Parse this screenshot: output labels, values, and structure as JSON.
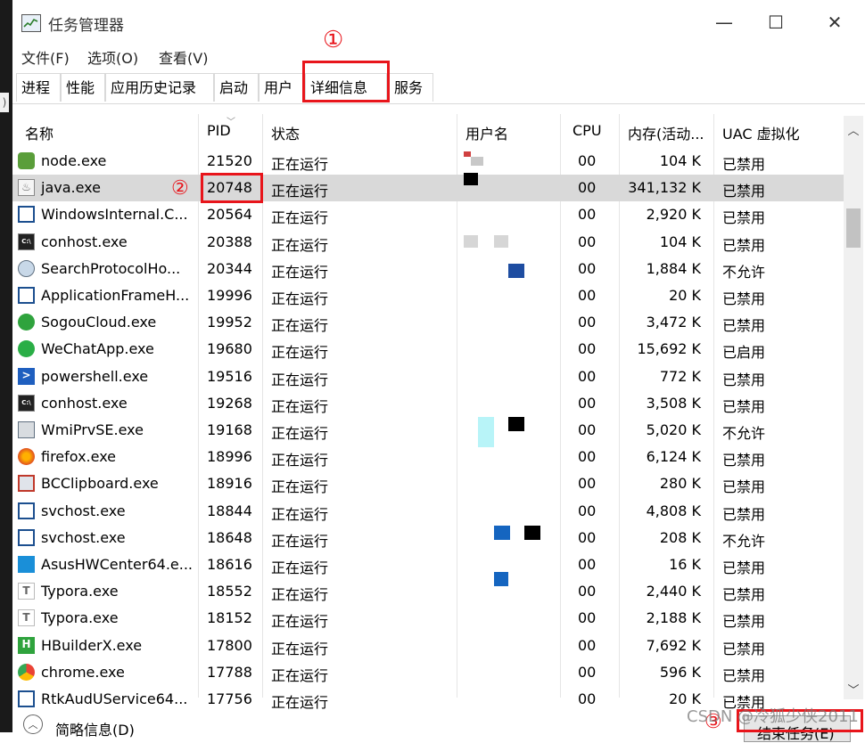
{
  "window": {
    "title": "任务管理器",
    "controls": {
      "minimize": "—",
      "maximize": "☐",
      "close": "✕"
    }
  },
  "menu": [
    "文件(F)",
    "选项(O)",
    "查看(V)"
  ],
  "tabs": [
    "进程",
    "性能",
    "应用历史记录",
    "启动",
    "用户",
    "详细信息",
    "服务"
  ],
  "active_tab": "详细信息",
  "annotations": {
    "one": "①",
    "two": "②",
    "three": "③"
  },
  "columns": {
    "name": "名称",
    "pid": "PID",
    "status": "状态",
    "user": "用户名",
    "cpu": "CPU",
    "memory": "内存(活动...",
    "uac": "UAC 虚拟化"
  },
  "rows": [
    {
      "name": "node.exe",
      "pid": "21520",
      "status": "正在运行",
      "cpu": "00",
      "memory": "104 K",
      "uac": "已禁用",
      "icon": "node-icon"
    },
    {
      "name": "java.exe",
      "pid": "20748",
      "status": "正在运行",
      "cpu": "00",
      "memory": "341,132 K",
      "uac": "已禁用",
      "icon": "java-icon"
    },
    {
      "name": "WindowsInternal.C...",
      "pid": "20564",
      "status": "正在运行",
      "cpu": "00",
      "memory": "2,920 K",
      "uac": "已禁用",
      "icon": "window-app-icon"
    },
    {
      "name": "conhost.exe",
      "pid": "20388",
      "status": "正在运行",
      "cpu": "00",
      "memory": "104 K",
      "uac": "已禁用",
      "icon": "console-icon"
    },
    {
      "name": "SearchProtocolHo...",
      "pid": "20344",
      "status": "正在运行",
      "cpu": "00",
      "memory": "1,884 K",
      "uac": "不允许",
      "icon": "search-user-icon"
    },
    {
      "name": "ApplicationFrameH...",
      "pid": "19996",
      "status": "正在运行",
      "cpu": "00",
      "memory": "20 K",
      "uac": "已禁用",
      "icon": "window-app-icon"
    },
    {
      "name": "SogouCloud.exe",
      "pid": "19952",
      "status": "正在运行",
      "cpu": "00",
      "memory": "3,472 K",
      "uac": "已禁用",
      "icon": "sogou-icon"
    },
    {
      "name": "WeChatApp.exe",
      "pid": "19680",
      "status": "正在运行",
      "cpu": "00",
      "memory": "15,692 K",
      "uac": "已启用",
      "icon": "wechat-icon"
    },
    {
      "name": "powershell.exe",
      "pid": "19516",
      "status": "正在运行",
      "cpu": "00",
      "memory": "772 K",
      "uac": "已禁用",
      "icon": "powershell-icon"
    },
    {
      "name": "conhost.exe",
      "pid": "19268",
      "status": "正在运行",
      "cpu": "00",
      "memory": "3,508 K",
      "uac": "已禁用",
      "icon": "console-icon"
    },
    {
      "name": "WmiPrvSE.exe",
      "pid": "19168",
      "status": "正在运行",
      "cpu": "00",
      "memory": "5,020 K",
      "uac": "不允许",
      "icon": "wmi-icon"
    },
    {
      "name": "firefox.exe",
      "pid": "18996",
      "status": "正在运行",
      "cpu": "00",
      "memory": "6,124 K",
      "uac": "已禁用",
      "icon": "firefox-icon"
    },
    {
      "name": "BCClipboard.exe",
      "pid": "18916",
      "status": "正在运行",
      "cpu": "00",
      "memory": "280 K",
      "uac": "已禁用",
      "icon": "clipboard-icon"
    },
    {
      "name": "svchost.exe",
      "pid": "18844",
      "status": "正在运行",
      "cpu": "00",
      "memory": "4,808 K",
      "uac": "已禁用",
      "icon": "window-app-icon"
    },
    {
      "name": "svchost.exe",
      "pid": "18648",
      "status": "正在运行",
      "cpu": "00",
      "memory": "208 K",
      "uac": "不允许",
      "icon": "window-app-icon"
    },
    {
      "name": "AsusHWCenter64.e...",
      "pid": "18616",
      "status": "正在运行",
      "cpu": "00",
      "memory": "16 K",
      "uac": "已禁用",
      "icon": "asus-icon"
    },
    {
      "name": "Typora.exe",
      "pid": "18552",
      "status": "正在运行",
      "cpu": "00",
      "memory": "2,440 K",
      "uac": "已禁用",
      "icon": "typora-icon"
    },
    {
      "name": "Typora.exe",
      "pid": "18152",
      "status": "正在运行",
      "cpu": "00",
      "memory": "2,188 K",
      "uac": "已禁用",
      "icon": "typora-icon"
    },
    {
      "name": "HBuilderX.exe",
      "pid": "17800",
      "status": "正在运行",
      "cpu": "00",
      "memory": "7,692 K",
      "uac": "已禁用",
      "icon": "hbuilder-icon"
    },
    {
      "name": "chrome.exe",
      "pid": "17788",
      "status": "正在运行",
      "cpu": "00",
      "memory": "596 K",
      "uac": "已禁用",
      "icon": "chrome-icon"
    },
    {
      "name": "RtkAudUService64...",
      "pid": "17756",
      "status": "正在运行",
      "cpu": "00",
      "memory": "20 K",
      "uac": "已禁用",
      "icon": "window-app-icon"
    }
  ],
  "selected_row": 1,
  "footer": {
    "fewer_details": "简略信息(D)",
    "end_task": "结束任务(E)"
  },
  "watermark": "CSDN @冷狐少侠2011",
  "colors": {
    "highlight": "#e8151b",
    "selection": "#d9d9d9"
  }
}
